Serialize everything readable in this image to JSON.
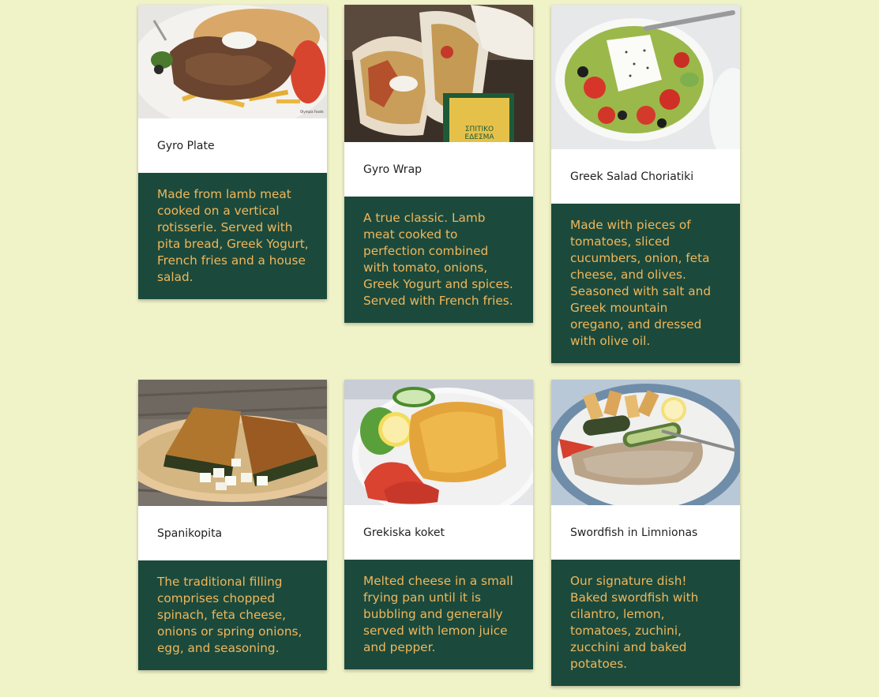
{
  "colors": {
    "page_background": "#f0f2c8",
    "card_body": "#ffffff",
    "description_background": "#1b4a3c",
    "description_text": "#f0b65b"
  },
  "menu": {
    "items": [
      {
        "title": "Gyro Plate",
        "description": "Made from lamb meat cooked on a vertical rotisserie. Served with pita bread, Greek Yogurt, French fries and a house salad.",
        "image": "gyro-plate-photo",
        "image_watermark": "Olympia Foods"
      },
      {
        "title": "Gyro Wrap",
        "description": "A true classic. Lamb meat cooked to perfection combined with tomato, onions, Greek Yogurt and spices. Served with French fries.",
        "image": "gyro-wrap-photo",
        "image_sign_lines": [
          "ΣΠΙΤΙΚΟ",
          "ΕΔΕΣΜΑ"
        ]
      },
      {
        "title": "Greek Salad Choriatiki",
        "description": "Made with pieces of tomatoes, sliced cucumbers, onion, feta cheese, and olives. Seasoned with salt and Greek mountain oregano, and dressed with olive oil.",
        "image": "greek-salad-photo"
      },
      {
        "title": "Spanikopita",
        "description": "The traditional filling comprises chopped spinach, feta cheese, onions or spring onions, egg, and seasoning.",
        "image": "spanikopita-photo"
      },
      {
        "title": "Grekiska koket",
        "description": "Melted cheese in a small frying pan until it is bubbling and generally served with lemon juice and pepper.",
        "image": "grekiska-koket-photo"
      },
      {
        "title": "Swordfish in Limnionas",
        "description": "Our signature dish! Baked swordfish with cilantro, lemon, tomatoes, zuchini, zucchini and baked potatoes.",
        "image": "swordfish-photo"
      }
    ]
  }
}
